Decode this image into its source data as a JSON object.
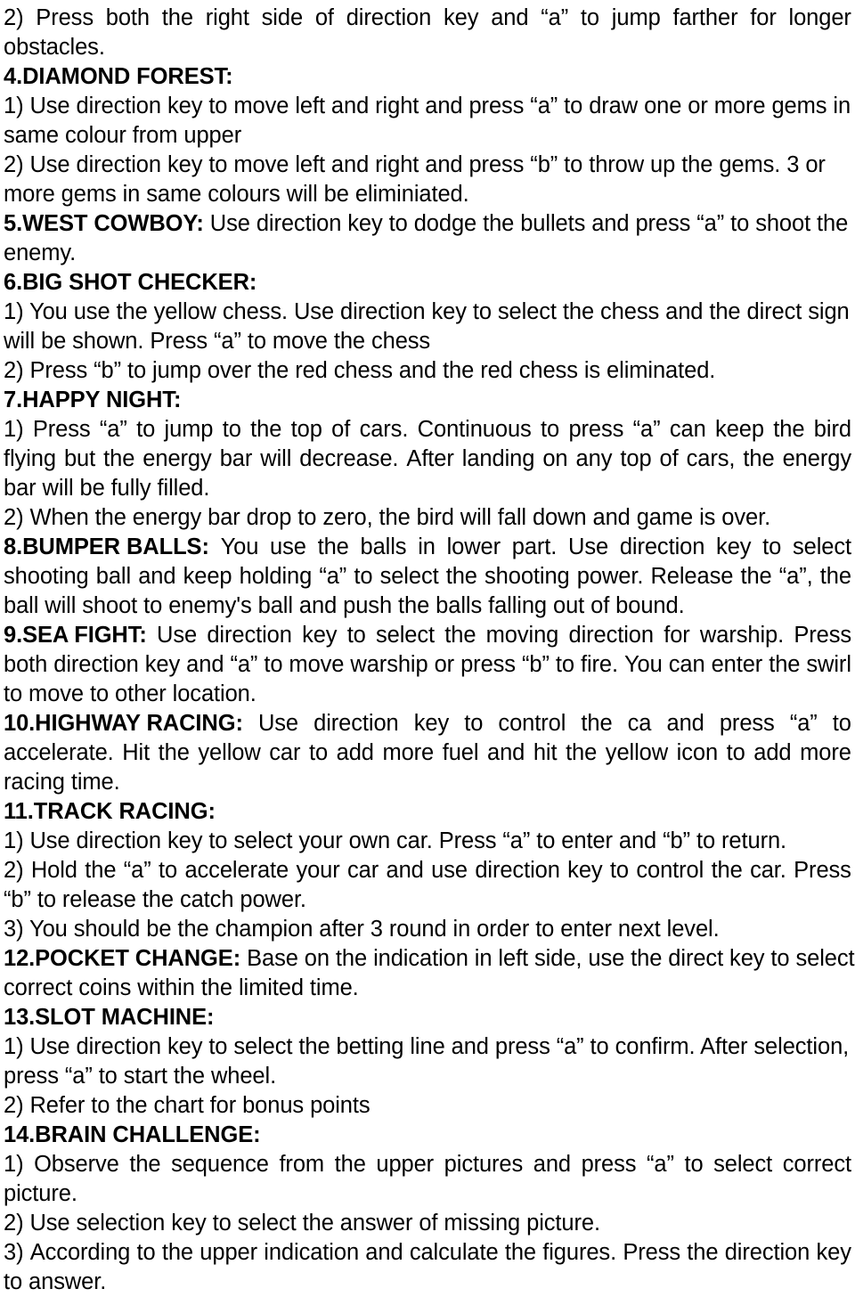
{
  "document": {
    "type": "game-instruction-manual-page",
    "background_color": "#ffffff",
    "text_color": "#000000",
    "alignment": "justified",
    "lines": [
      {
        "id": "l01",
        "justified": true,
        "bold_prefix": "",
        "words": [
          "2)",
          "Press",
          "both",
          "the",
          "right",
          "side",
          "of",
          "direction",
          "key",
          "and",
          "“a”",
          "to",
          "jump",
          "farther",
          "for",
          "longer"
        ]
      },
      {
        "id": "l02",
        "justified": false,
        "bold_prefix": "",
        "text": "obstacles."
      },
      {
        "id": "l03",
        "justified": false,
        "bold_prefix": "4.DIAMOND FOREST:",
        "text": ""
      },
      {
        "id": "l04",
        "justified": false,
        "bold_prefix": "",
        "text": "1) Use direction key to move left and right and press “a” to draw one or more gems in"
      },
      {
        "id": "l05",
        "justified": false,
        "bold_prefix": "",
        "text": "same colour from upper"
      },
      {
        "id": "l06",
        "justified": false,
        "bold_prefix": "",
        "text": "2) Use direction key to move left and right and press “b” to throw up the gems. 3 or"
      },
      {
        "id": "l07",
        "justified": false,
        "bold_prefix": "",
        "text": "more gems in same colours will be eliminiated."
      },
      {
        "id": "l08",
        "justified": false,
        "bold_prefix": "5.WEST COWBOY:",
        "text": " Use direction key to dodge the bullets and press “a” to shoot the"
      },
      {
        "id": "l09",
        "justified": false,
        "bold_prefix": "",
        "text": "enemy."
      },
      {
        "id": "l10",
        "justified": false,
        "bold_prefix": "6.BIG SHOT CHECKER:",
        "text": ""
      },
      {
        "id": "l11",
        "justified": false,
        "bold_prefix": "",
        "text": "1) You use the yellow chess. Use direction key to select the chess and the direct sign"
      },
      {
        "id": "l12",
        "justified": false,
        "bold_prefix": "",
        "text": "will be shown. Press “a” to move the chess"
      },
      {
        "id": "l13",
        "justified": false,
        "bold_prefix": "",
        "text": "2) Press “b” to jump over the red chess and the red chess is eliminated."
      },
      {
        "id": "l14",
        "justified": false,
        "bold_prefix": "7.HAPPY NIGHT:",
        "text": ""
      },
      {
        "id": "l15",
        "justified": true,
        "bold_prefix": "",
        "words": [
          "1)",
          "Press",
          "“a”",
          "to",
          "jump",
          "to",
          "the",
          "top",
          "of",
          "cars.",
          "Continuous",
          "to",
          "press",
          "“a”",
          "can",
          "keep",
          "the",
          "bird"
        ]
      },
      {
        "id": "l16",
        "justified": true,
        "bold_prefix": "",
        "words": [
          "flying",
          "but",
          "the",
          "energy",
          "bar",
          "will",
          "decrease.",
          "After",
          "landing",
          "on",
          "any",
          "top",
          "of",
          "cars,",
          "the",
          "energy"
        ]
      },
      {
        "id": "l17",
        "justified": false,
        "bold_prefix": "",
        "text": "bar will be fully filled."
      },
      {
        "id": "l18",
        "justified": false,
        "bold_prefix": "",
        "text": "2) When the energy bar drop to zero, the bird will fall down and game is over."
      },
      {
        "id": "l19",
        "justified": true,
        "bold_prefix": "8.BUMPER BALLS:",
        "words": [
          "You",
          "use",
          "the",
          "balls",
          "in",
          "lower",
          "part.",
          "Use",
          "direction",
          "key",
          "to",
          "select"
        ]
      },
      {
        "id": "l20",
        "justified": true,
        "bold_prefix": "",
        "words": [
          "shooting",
          "ball",
          "and",
          "keep",
          "holding",
          "“a”",
          "to",
          "select",
          "the",
          "shooting",
          "power.",
          "Release",
          "the",
          "“a”,",
          "the"
        ]
      },
      {
        "id": "l21",
        "justified": false,
        "bold_prefix": "",
        "text": "ball will shoot to enemy's ball and push the balls falling out of bound."
      },
      {
        "id": "l22",
        "justified": true,
        "bold_prefix": "9.SEA FIGHT:",
        "words": [
          "Use",
          "direction",
          "key",
          "to",
          "select",
          "the",
          "moving",
          "direction",
          "for",
          "warship.",
          "Press"
        ]
      },
      {
        "id": "l23",
        "justified": true,
        "bold_prefix": "",
        "words": [
          "both",
          "direction",
          "key",
          "and",
          "“a”",
          "to",
          "move",
          "warship",
          "or",
          "press",
          "“b”",
          "to",
          "fire.",
          "You",
          "can",
          "enter",
          "the",
          "swirl"
        ]
      },
      {
        "id": "l24",
        "justified": false,
        "bold_prefix": "",
        "text": "to move to other location."
      },
      {
        "id": "l25",
        "justified": true,
        "bold_prefix": "10.HIGHWAY RACING:",
        "words": [
          "Use",
          "direction",
          "key",
          "to",
          "control",
          "the",
          "ca",
          "and",
          "press",
          "“a”",
          "to"
        ]
      },
      {
        "id": "l26",
        "justified": true,
        "bold_prefix": "",
        "words": [
          "accelerate.",
          "Hit",
          "the",
          "yellow",
          "car",
          "to",
          "add",
          "more",
          "fuel",
          "and",
          "hit",
          "the",
          "yellow",
          "icon",
          "to",
          "add",
          "more"
        ]
      },
      {
        "id": "l27",
        "justified": false,
        "bold_prefix": "",
        "text": "racing time."
      },
      {
        "id": "l28",
        "justified": false,
        "bold_prefix": "11.TRACK RACING:",
        "text": ""
      },
      {
        "id": "l29",
        "justified": false,
        "bold_prefix": "",
        "text": "1) Use direction key to select your own car. Press “a” to enter and “b” to return."
      },
      {
        "id": "l30",
        "justified": true,
        "bold_prefix": "",
        "words": [
          "2)",
          "Hold",
          "the",
          "“a”",
          "to",
          "accelerate",
          "your",
          "car",
          "and",
          "use",
          "direction",
          "key",
          "to",
          "control",
          "the",
          "car.",
          "Press"
        ]
      },
      {
        "id": "l31",
        "justified": false,
        "bold_prefix": "",
        "text": "“b” to release the catch power."
      },
      {
        "id": "l32",
        "justified": false,
        "bold_prefix": "",
        "text": "3) You should be the champion after 3 round in order to enter next level."
      },
      {
        "id": "l33",
        "justified": false,
        "bold_prefix": "12.POCKET CHANGE:",
        "text": " Base on the indication in left side, use the direct key to select"
      },
      {
        "id": "l34",
        "justified": false,
        "bold_prefix": "",
        "text": "correct coins within the limited time."
      },
      {
        "id": "l35",
        "justified": false,
        "bold_prefix": "13.SLOT MACHINE:",
        "text": ""
      },
      {
        "id": "l36",
        "justified": false,
        "bold_prefix": "",
        "text": "1) Use direction key to select the betting line and press “a” to confirm. After selection,"
      },
      {
        "id": "l37",
        "justified": false,
        "bold_prefix": "",
        "text": "press “a” to start the wheel."
      },
      {
        "id": "l38",
        "justified": false,
        "bold_prefix": "",
        "text": "2) Refer to the chart for bonus points"
      },
      {
        "id": "l39",
        "justified": false,
        "bold_prefix": "14.BRAIN CHALLENGE:",
        "text": ""
      },
      {
        "id": "l40",
        "justified": true,
        "bold_prefix": "",
        "words": [
          "1)",
          "Observe",
          "the",
          "sequence",
          "from",
          "the",
          "upper",
          "pictures",
          "and",
          "press",
          "“a”",
          "to",
          "select",
          "correct"
        ]
      },
      {
        "id": "l41",
        "justified": false,
        "bold_prefix": "",
        "text": "picture."
      },
      {
        "id": "l42",
        "justified": false,
        "bold_prefix": "",
        "text": "2) Use selection key to select the answer of missing picture."
      },
      {
        "id": "l43",
        "justified": true,
        "bold_prefix": "",
        "words": [
          "3)",
          "According",
          "to",
          "the",
          "upper",
          "indication",
          "and",
          "calculate",
          "the",
          "figures.",
          "Press",
          "the",
          "direction",
          "key"
        ]
      },
      {
        "id": "l44",
        "justified": false,
        "bold_prefix": "",
        "text": "to answer."
      }
    ],
    "sections": [
      {
        "number": "4",
        "title": "DIAMOND FOREST"
      },
      {
        "number": "5",
        "title": "WEST COWBOY"
      },
      {
        "number": "6",
        "title": "BIG SHOT CHECKER"
      },
      {
        "number": "7",
        "title": "HAPPY NIGHT"
      },
      {
        "number": "8",
        "title": "BUMPER BALLS"
      },
      {
        "number": "9",
        "title": "SEA FIGHT"
      },
      {
        "number": "10",
        "title": "HIGHWAY RACING"
      },
      {
        "number": "11",
        "title": "TRACK RACING"
      },
      {
        "number": "12",
        "title": "POCKET CHANGE"
      },
      {
        "number": "13",
        "title": "SLOT MACHINE"
      },
      {
        "number": "14",
        "title": "BRAIN CHALLENGE"
      }
    ]
  }
}
